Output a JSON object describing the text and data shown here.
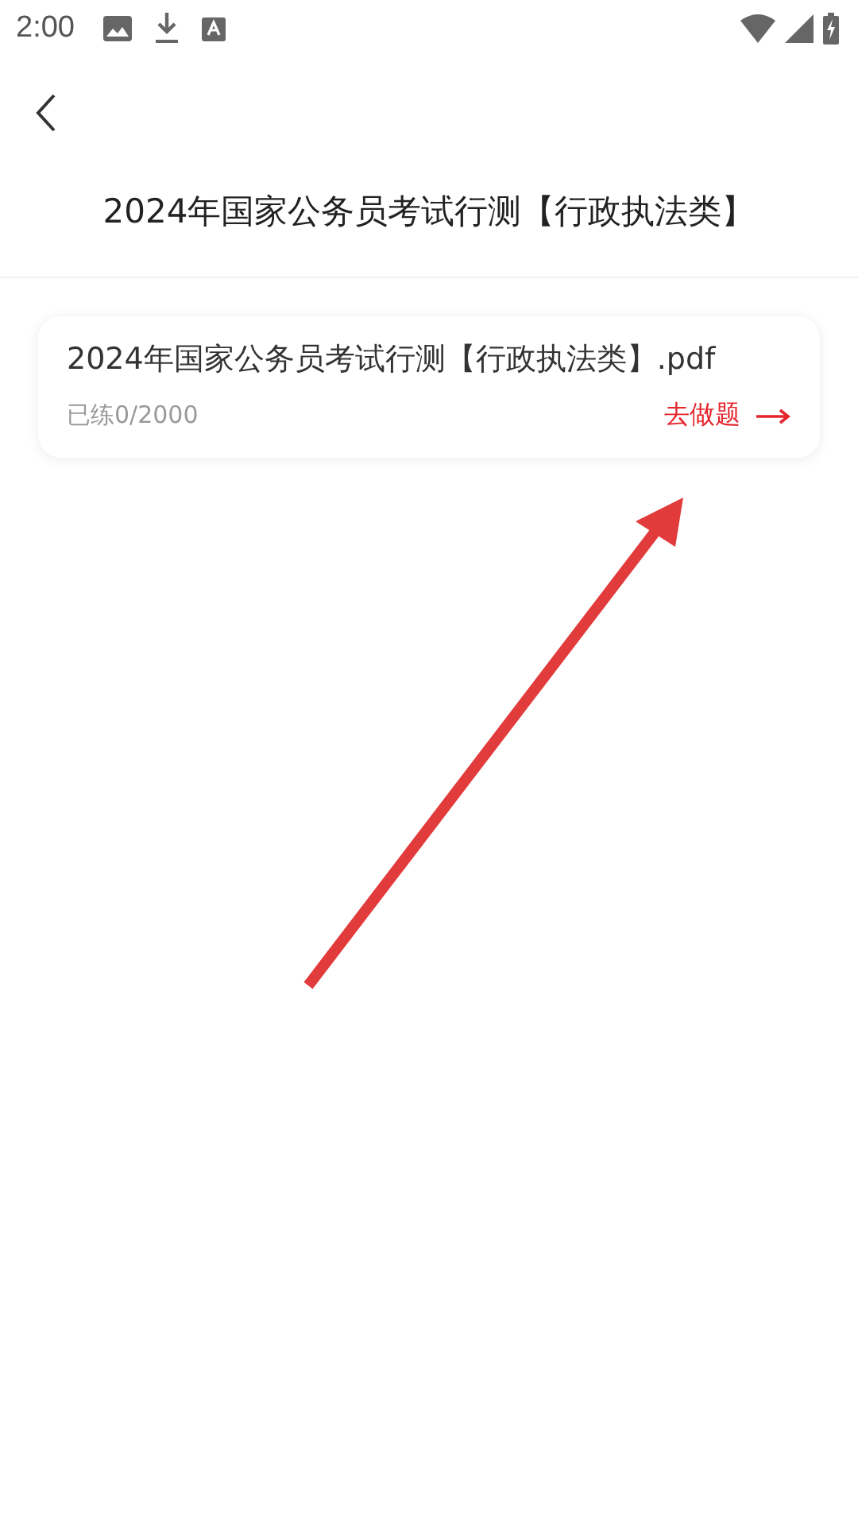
{
  "status_bar": {
    "time": "2:00"
  },
  "header": {
    "title": "2024年国家公务员考试行测【行政执法类】"
  },
  "files": [
    {
      "name": "2024年国家公务员考试行测【行政执法类】.pdf",
      "progress": "已练0/2000",
      "action": "去做题"
    }
  ],
  "annotation": {
    "kind": "arrow"
  }
}
